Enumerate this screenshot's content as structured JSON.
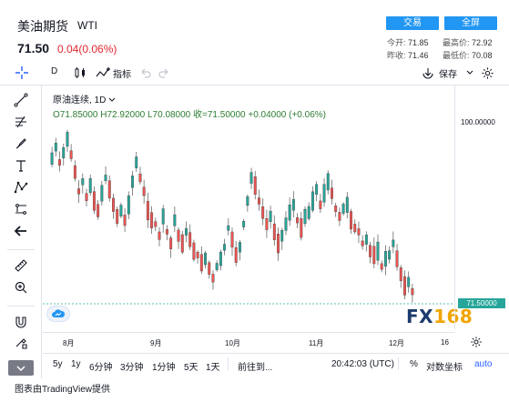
{
  "header": {
    "title_cn": "美油期货",
    "title_code": "WTI",
    "price": "71.50",
    "change": "0.04(0.06%)",
    "trade_button": "交易",
    "fullscreen_button": "全屏",
    "stats": {
      "open_label": "今开:",
      "open_value": "71.85",
      "high_label": "最高价:",
      "high_value": "72.92",
      "prev_label": "昨收:",
      "prev_value": "71.46",
      "low_label": "最低价:",
      "low_value": "70.08"
    },
    "colors": {
      "down": "#e0262f",
      "button": "#2196f3"
    }
  },
  "toolbar": {
    "interval": "D",
    "indicators_label": "指标",
    "save_label": "保存"
  },
  "legend": {
    "symbol_line": "原油连续, 1D",
    "ohlc_line": "O71.85000  H72.92000  L70.08000  收=71.50000  +0.04000 (+0.06%)"
  },
  "price_axis": {
    "top_label": "100.00000",
    "last_price_tag": "71.50000"
  },
  "time_axis": {
    "labels": [
      "8月",
      "9月",
      "10月",
      "11月",
      "12月",
      "16"
    ]
  },
  "bottom_bar": {
    "ranges": [
      "5y",
      "1y",
      "6分钟",
      "3分钟",
      "1分钟",
      "5天",
      "1天"
    ],
    "goto_label": "前往到...",
    "time": "20:42:03 (UTC)",
    "percent_label": "%",
    "log_label": "对数坐标",
    "auto_label": "auto"
  },
  "watermark": {
    "fx": "FX",
    "num": "168"
  },
  "footer": "图表由TradingView提供",
  "chart_data": {
    "type": "candlestick",
    "up_color": "#26a69a",
    "down_color": "#ef5350",
    "last_close": 71.5,
    "price_line": 71.5,
    "note_axis_top": 100.0
  }
}
